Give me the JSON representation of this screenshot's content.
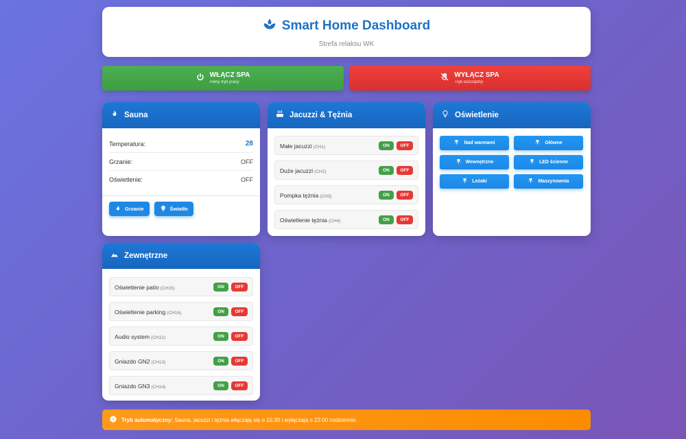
{
  "header": {
    "title": "Smart Home Dashboard",
    "subtitle": "Strefa relaksu WK",
    "icon": "spa-icon"
  },
  "spa_controls": {
    "on": {
      "label": "WŁĄCZ SPA",
      "sub": "Pełny tryb pracy",
      "color": "#4caf50",
      "icon": "power-icon"
    },
    "off": {
      "label": "WYŁĄCZ SPA",
      "sub": "Tryb oszczędny",
      "color": "#e53935",
      "icon": "hand-off-icon"
    }
  },
  "sauna": {
    "title": "Sauna",
    "rows": [
      {
        "label": "Temperatura:",
        "value": "28"
      },
      {
        "label": "Grzanie:",
        "value": "OFF"
      },
      {
        "label": "Oświetlenie:",
        "value": "OFF"
      }
    ],
    "buttons": {
      "heat": "Grzanie",
      "light": "Światło"
    }
  },
  "jacuzzi": {
    "title": "Jacuzzi & Tężnia",
    "rows": [
      {
        "name": "Małe jacuzzi",
        "code": "(CH1)"
      },
      {
        "name": "Duże jacuzzi",
        "code": "(CH2)"
      },
      {
        "name": "Pompka tężnia",
        "code": "(CH3)"
      },
      {
        "name": "Oświetlenie tężnia",
        "code": "(CH4)"
      }
    ]
  },
  "lighting": {
    "title": "Oświetlenie",
    "buttons": [
      "Nad wannami",
      "Główne",
      "Wewnętrzne",
      "LED ścienne",
      "Leżaki",
      "Maszynownia"
    ]
  },
  "outdoor": {
    "title": "Zewnętrzne",
    "rows": [
      {
        "name": "Oświetlenie patio",
        "code": "(CH15)"
      },
      {
        "name": "Oświetlenie parking",
        "code": "(CH16)"
      },
      {
        "name": "Audio system",
        "code": "(CH12)"
      },
      {
        "name": "Gniazdo GN2",
        "code": "(CH13)"
      },
      {
        "name": "Gniazdo GN3",
        "code": "(CH14)"
      }
    ]
  },
  "toggle": {
    "on": "ON",
    "off": "OFF"
  },
  "info": {
    "bold": "Tryb automatyczny:",
    "text": "Sauna, jacuzzi i tężnia włączają się o 15:30 i wyłączają o 22:00 codziennie."
  },
  "colors": {
    "accent": "#1f72c4",
    "header_blue": "#1766bf",
    "on": "#43a047",
    "off": "#e53935",
    "info": "#fb8c00"
  }
}
